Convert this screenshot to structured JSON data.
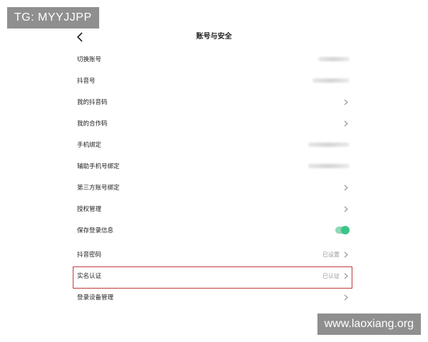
{
  "watermarks": {
    "top_left": "TG: MYYJJPP",
    "bottom_right": "www.laoxiang.org"
  },
  "header": {
    "title": "账号与安全",
    "back_icon": "chevron-left-icon"
  },
  "rows": [
    {
      "label": "切换账号",
      "value": "",
      "blurred": true,
      "chevron": false
    },
    {
      "label": "抖音号",
      "value": "",
      "blurred": true,
      "chevron": false
    },
    {
      "label": "我的抖音码",
      "value": "",
      "chevron": true
    },
    {
      "label": "我的合作码",
      "value": "",
      "chevron": true
    },
    {
      "label": "手机绑定",
      "value": "",
      "blurred": true,
      "chevron": false
    },
    {
      "label": "辅助手机号绑定",
      "value": "",
      "blurred": true,
      "chevron": false
    },
    {
      "label": "第三方账号绑定",
      "value": "",
      "chevron": true
    },
    {
      "label": "授权管理",
      "value": "",
      "chevron": true
    },
    {
      "label": "保存登录信息",
      "toggle": true,
      "toggle_on": true
    },
    {
      "label": "抖音密码",
      "value": "已设置",
      "chevron": true
    },
    {
      "label": "实名认证",
      "value": "已认证",
      "chevron": true,
      "highlighted": true
    },
    {
      "label": "登录设备管理",
      "value": "",
      "chevron": true
    }
  ],
  "colors": {
    "toggle_on": "#3cc487",
    "highlight_border": "#c03b3b"
  }
}
